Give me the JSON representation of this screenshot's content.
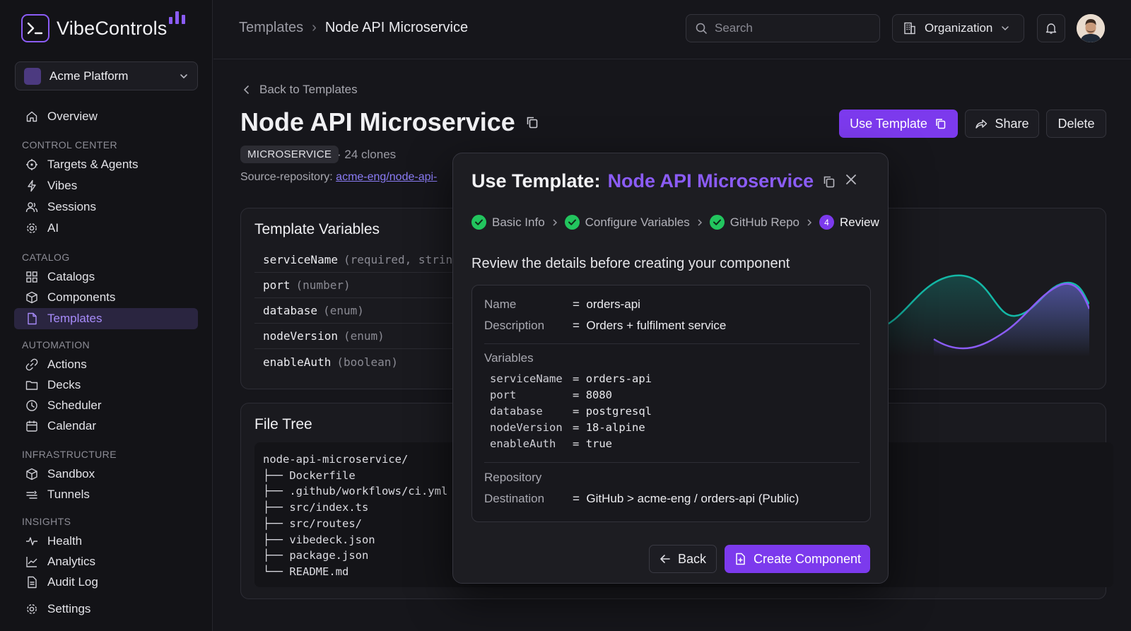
{
  "brand": {
    "name": "VibeControls"
  },
  "org_selector": {
    "name": "Acme Platform"
  },
  "nav": {
    "overview": "Overview",
    "sections": {
      "control_center": "CONTROL CENTER",
      "catalog": "CATALOG",
      "automation": "AUTOMATION",
      "infrastructure": "INFRASTRUCTURE",
      "insights": "INSIGHTS"
    },
    "items": {
      "targets_agents": "Targets & Agents",
      "vibes": "Vibes",
      "sessions": "Sessions",
      "ai": "AI",
      "catalogs": "Catalogs",
      "components": "Components",
      "templates": "Templates",
      "actions": "Actions",
      "decks": "Decks",
      "scheduler": "Scheduler",
      "calendar": "Calendar",
      "sandbox": "Sandbox",
      "tunnels": "Tunnels",
      "health": "Health",
      "analytics": "Analytics",
      "audit_log": "Audit Log"
    },
    "settings": "Settings",
    "active": "templates"
  },
  "header": {
    "breadcrumb": [
      "Templates",
      "Node API Microservice"
    ],
    "search_placeholder": "Search",
    "org_button": "Organization"
  },
  "page": {
    "back_label": "Back to Templates",
    "title": "Node API Microservice",
    "badge": "MICROSERVICE",
    "clones": "24 clones",
    "source_label": "Source-repository:",
    "source_link": "acme-eng/node-api-",
    "actions": {
      "use_template": "Use Template",
      "share": "Share",
      "delete": "Delete"
    }
  },
  "template_variables": {
    "title": "Template Variables",
    "rows": [
      {
        "name": "serviceName",
        "type": "(required, string)"
      },
      {
        "name": "port",
        "type": "(number)"
      },
      {
        "name": "database",
        "type": "(enum)"
      },
      {
        "name": "nodeVersion",
        "type": "(enum)"
      },
      {
        "name": "enableAuth",
        "type": "(boolean)"
      }
    ]
  },
  "file_tree": {
    "title": "File Tree",
    "lines": [
      "node-api-microservice/",
      "├── Dockerfile",
      "├── .github/workflows/ci.yml",
      "├── src/index.ts",
      "├── src/routes/",
      "├── vibedeck.json",
      "├── package.json",
      "└── README.md"
    ]
  },
  "modal": {
    "title_prefix": "Use Template:",
    "title_name": "Node API Microservice",
    "steps": [
      {
        "label": "Basic Info",
        "state": "done"
      },
      {
        "label": "Configure Variables",
        "state": "done"
      },
      {
        "label": "GitHub Repo",
        "state": "done"
      },
      {
        "label": "Review",
        "state": "current",
        "number": "4"
      }
    ],
    "intro": "Review the details before creating your component",
    "review": {
      "name_key": "Name",
      "name_value": "orders-api",
      "desc_key": "Description",
      "desc_value": "Orders + fulfilment service",
      "variables_heading": "Variables",
      "variables": [
        {
          "key": "serviceName",
          "value": "orders-api"
        },
        {
          "key": "port",
          "value": "8080"
        },
        {
          "key": "database",
          "value": "postgresql"
        },
        {
          "key": "nodeVersion",
          "value": "18-alpine"
        },
        {
          "key": "enableAuth",
          "value": "true"
        }
      ],
      "eq": "=",
      "repository_heading": "Repository",
      "dest_key": "Destination",
      "dest_value": "GitHub > acme-eng / orders-api (Public)"
    },
    "back_button": "Back",
    "create_button": "Create Component"
  },
  "colors": {
    "accent": "#7c3aed",
    "accent_text": "#8b5cf6",
    "success": "#22c55e",
    "chart_teal": "#14b8a6",
    "chart_purple": "#8b5cf6"
  }
}
